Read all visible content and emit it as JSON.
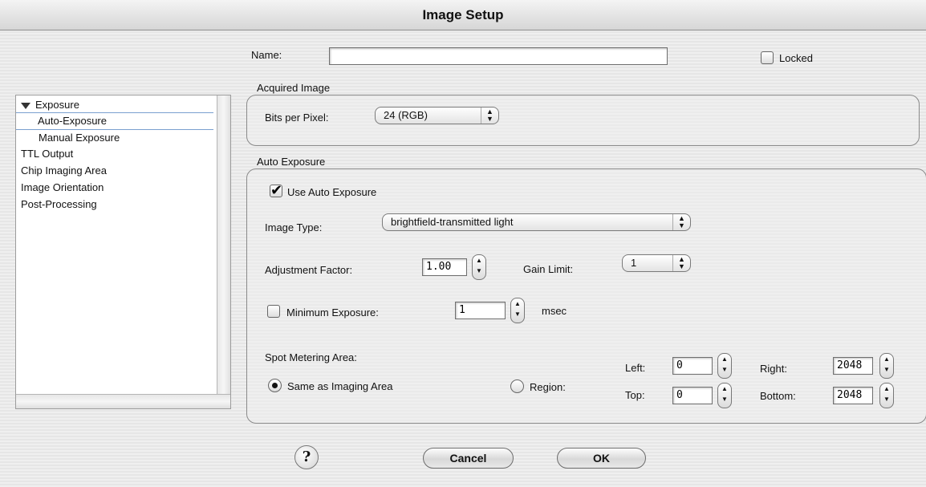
{
  "window": {
    "title": "Image Setup"
  },
  "sidebar": {
    "items": [
      {
        "label": "Exposure"
      },
      {
        "label": "Auto-Exposure"
      },
      {
        "label": "Manual Exposure"
      },
      {
        "label": "TTL Output"
      },
      {
        "label": "Chip Imaging Area"
      },
      {
        "label": "Image Orientation"
      },
      {
        "label": "Post-Processing"
      }
    ]
  },
  "name": {
    "label": "Name:",
    "value": ""
  },
  "locked": {
    "label": "Locked",
    "checked": false
  },
  "acquired": {
    "title": "Acquired Image",
    "bits_label": "Bits per Pixel:",
    "bits_value": "24 (RGB)"
  },
  "auto": {
    "title": "Auto Exposure",
    "use_label": "Use Auto Exposure",
    "use_checked": true,
    "image_type_label": "Image Type:",
    "image_type_value": "brightfield-transmitted light",
    "adjust_label": "Adjustment Factor:",
    "adjust_value": "1.00",
    "gain_label": "Gain Limit:",
    "gain_value": "1",
    "min_label": "Minimum Exposure:",
    "min_checked": false,
    "min_value": "1",
    "min_unit": "msec",
    "spot_label": "Spot Metering Area:",
    "same_label": "Same as Imaging Area",
    "region_label": "Region:",
    "left_label": "Left:",
    "left_value": "0",
    "top_label": "Top:",
    "top_value": "0",
    "right_label": "Right:",
    "right_value": "2048",
    "bottom_label": "Bottom:",
    "bottom_value": "2048"
  },
  "buttons": {
    "help": "?",
    "cancel": "Cancel",
    "ok": "OK"
  },
  "icons": {
    "disclosure": "disclosure-triangle-icon",
    "popup": "popup-arrows-icon",
    "stepper": "stepper-arrows-icon",
    "help": "help-icon"
  }
}
